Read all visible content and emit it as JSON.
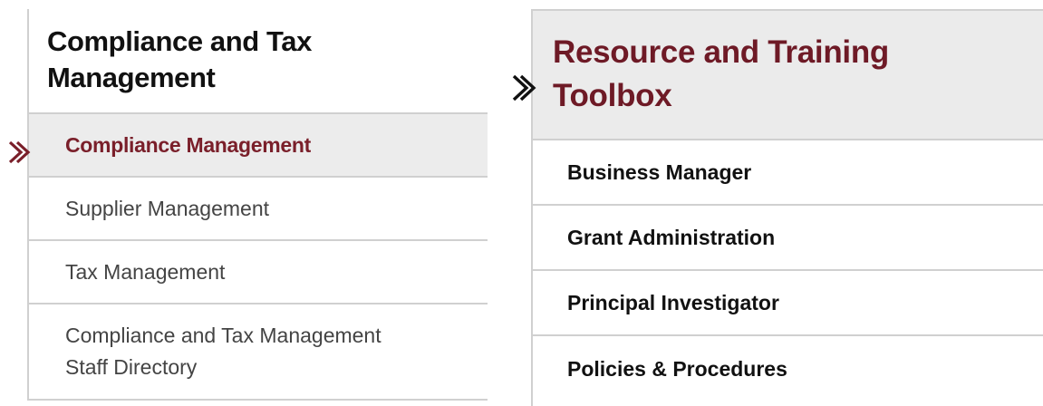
{
  "colors": {
    "accent": "#7a1f2a",
    "active_background": "#ececec",
    "header_background": "#ebebeb",
    "divider": "#d0d0d0"
  },
  "left_panel": {
    "title": "Compliance and Tax Management",
    "title_line1": "Compliance and Tax",
    "title_line2": "Management",
    "items": [
      {
        "label": "Compliance Management",
        "active": true
      },
      {
        "label": "Supplier Management",
        "active": false
      },
      {
        "label": "Tax Management",
        "active": false
      },
      {
        "label": "Compliance and Tax Management Staff Directory",
        "label_line1": "Compliance and Tax Management",
        "label_line2": "Staff Directory",
        "active": false
      }
    ],
    "active_marker_icon": "double-chevron-right-icon"
  },
  "right_panel": {
    "title": "Resource and Training Toolbox",
    "title_line1": "Resource and Training",
    "title_line2": "Toolbox",
    "items": [
      {
        "label": "Business Manager"
      },
      {
        "label": "Grant Administration"
      },
      {
        "label": "Principal Investigator"
      },
      {
        "label": "Policies & Procedures"
      }
    ],
    "active_marker_icon": "double-chevron-right-icon"
  }
}
